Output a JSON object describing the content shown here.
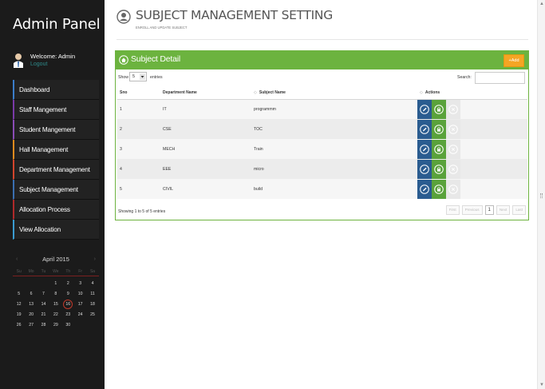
{
  "sidebar": {
    "brand": "Admin Panel",
    "welcome": "Welcome: Admin",
    "logout": "Logout",
    "items": [
      {
        "label": "Dashboard",
        "accent": "#3a7dc9"
      },
      {
        "label": "Staff Mangement",
        "accent": "#7a3aa8"
      },
      {
        "label": "Student Mangement",
        "accent": "#8a4cb6"
      },
      {
        "label": "Hall Management",
        "accent": "#e08a1e"
      },
      {
        "label": "Department Management",
        "accent": "#d2452c"
      },
      {
        "label": "Subject Management",
        "accent": "#3a6fb0"
      },
      {
        "label": "Allocation Process",
        "accent": "#b02a2a"
      },
      {
        "label": "View Allocation",
        "accent": "#3a9bd0"
      }
    ],
    "calendar": {
      "month": "April 2015",
      "prev": "‹",
      "next": "›",
      "dows": [
        "Su",
        "Mo",
        "Tu",
        "We",
        "Th",
        "Fr",
        "Sa"
      ],
      "days": [
        "",
        "",
        "",
        "1",
        "2",
        "3",
        "4",
        "5",
        "6",
        "7",
        "8",
        "9",
        "10",
        "11",
        "12",
        "13",
        "14",
        "15",
        "16",
        "17",
        "18",
        "19",
        "20",
        "21",
        "22",
        "23",
        "24",
        "25",
        "26",
        "27",
        "28",
        "29",
        "30"
      ],
      "today": "16"
    }
  },
  "header": {
    "title": "SUBJECT MANAGEMENT SETTING",
    "subtitle": "ENROLL AND UPDATE SUBJECT"
  },
  "panel": {
    "title": "Subject Detail",
    "add_label": "+Add",
    "show_label": "Show",
    "page_length": "5",
    "entries_label": "entries",
    "search_label": "Search:",
    "columns": [
      "Sno",
      "Department Name",
      "Subject Name",
      "Actions"
    ],
    "rows": [
      {
        "sno": "1",
        "dept": "IT",
        "subject": "programmm"
      },
      {
        "sno": "2",
        "dept": "CSE",
        "subject": "TOC"
      },
      {
        "sno": "3",
        "dept": "MECH",
        "subject": "Train"
      },
      {
        "sno": "4",
        "dept": "EEE",
        "subject": "micro"
      },
      {
        "sno": "5",
        "dept": "CIVIL",
        "subject": "build"
      }
    ],
    "info": "Showing 1 to 5 of 5 entries",
    "pager": {
      "first": "First",
      "previous": "Previous",
      "current": "1",
      "next": "Next",
      "last": "Last"
    }
  },
  "colors": {
    "sidebar_bg": "#1b1b1b",
    "panel_green": "#6cb33f",
    "edit_blue": "#2a5c90",
    "add_orange": "#f5a524"
  },
  "icons": {
    "user": "user-icon",
    "header": "user-circle-icon",
    "panel": "home-circle-icon",
    "edit": "pencil-icon",
    "lock": "lock-icon",
    "delete": "close-icon"
  }
}
